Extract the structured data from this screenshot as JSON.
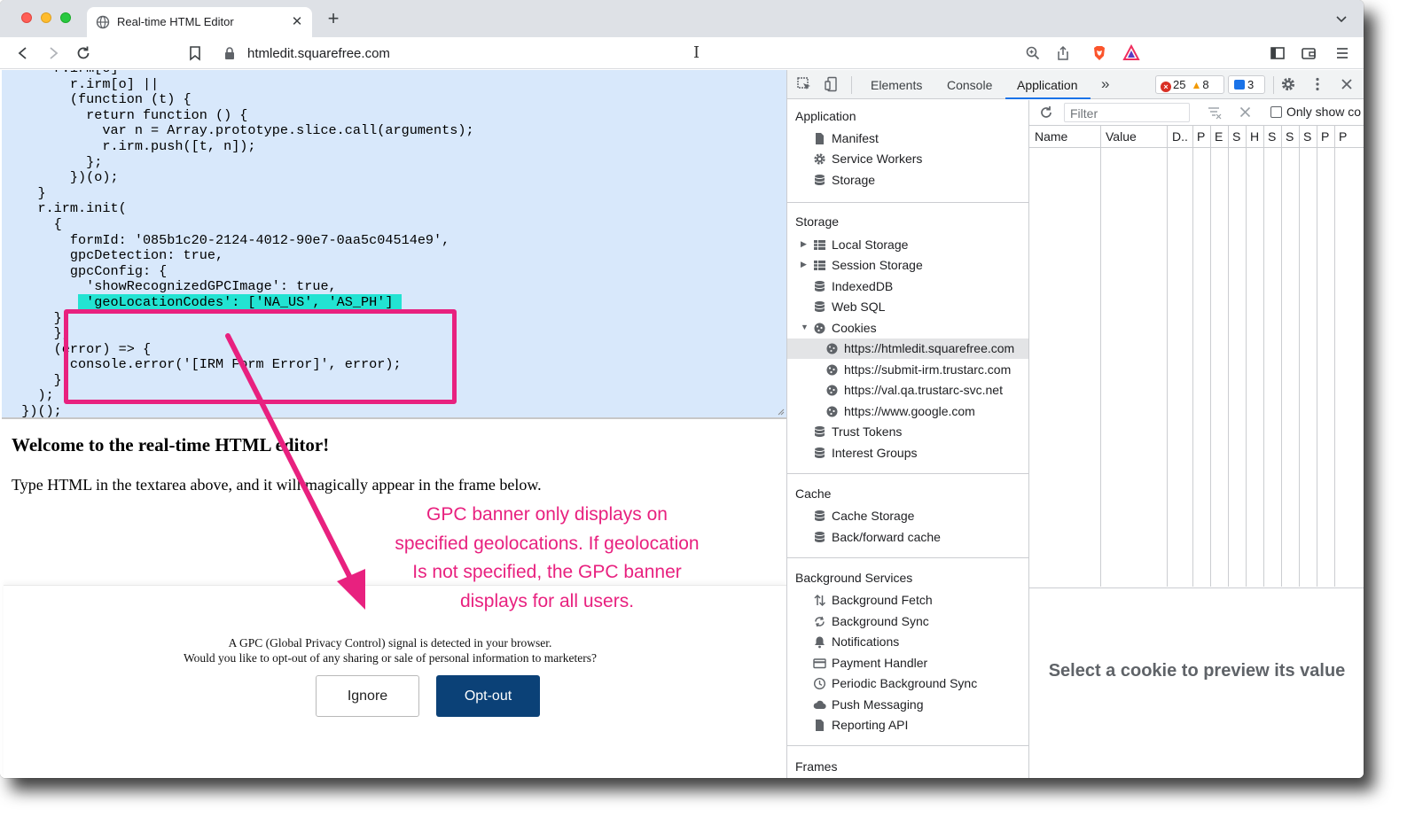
{
  "browser": {
    "tab_title": "Real-time HTML Editor",
    "new_tab_symbol": "+",
    "tab_close_symbol": "✕",
    "url": "htmledit.squarefree.com",
    "brand_color": "#fb542b"
  },
  "editor": {
    "code_lines": [
      "      r.irm[o] =",
      "        r.irm[o] ||",
      "        (function (t) {",
      "          return function () {",
      "            var n = Array.prototype.slice.call(arguments);",
      "            r.irm.push([t, n]);",
      "          };",
      "        })(o);",
      "    }",
      "    r.irm.init(",
      "      {",
      "        formId: '085b1c20-2124-4012-90e7-0aa5c04514e9',",
      "        gpcDetection: true,",
      "        gpcConfig: {",
      "          'showRecognizedGPCImage': true,",
      "          'geoLocationCodes': ['NA_US', 'AS_PH']",
      "      }",
      "      },",
      "      (error) => {",
      "        console.error('[IRM Form Error]', error);",
      "      }",
      "    );",
      "  })();"
    ],
    "highlight_text": "'geoLocationCodes': ['NA_US', 'AS_PH']",
    "highlight_color": "#22e3d2"
  },
  "frame": {
    "heading": "Welcome to the real-time HTML editor!",
    "intro": "Type HTML in the textarea above, and it will magically appear in the frame below."
  },
  "gpc_banner": {
    "line1": "A GPC (Global Privacy Control) signal is detected in your browser.",
    "line2": "Would you like to opt-out of any sharing or sale of personal information to marketers?",
    "ignore_label": "Ignore",
    "optout_label": "Opt-out",
    "optout_color": "#0b4177"
  },
  "annotation": {
    "lines": [
      "GPC banner only displays on",
      "specified geolocations. If geolocation",
      "Is not specified, the GPC banner",
      "displays for all users."
    ],
    "color": "#e8217f"
  },
  "devtools": {
    "tabs": [
      "Elements",
      "Console",
      "Application"
    ],
    "active_tab": "Application",
    "more_tabs_symbol": "»",
    "errors": "25",
    "warnings": "8",
    "messages": "3",
    "sidebar": {
      "application_title": "Application",
      "application_items": [
        "Manifest",
        "Service Workers",
        "Storage"
      ],
      "storage_title": "Storage",
      "storage_items": [
        "Local Storage",
        "Session Storage",
        "IndexedDB",
        "Web SQL",
        "Cookies"
      ],
      "cookie_origins": [
        "https://htmledit.squarefree.com",
        "https://submit-irm.trustarc.com",
        "https://val.qa.trustarc-svc.net",
        "https://www.google.com"
      ],
      "selected_origin": "https://htmledit.squarefree.com",
      "storage_items_after": [
        "Trust Tokens",
        "Interest Groups"
      ],
      "cache_title": "Cache",
      "cache_items": [
        "Cache Storage",
        "Back/forward cache"
      ],
      "background_title": "Background Services",
      "background_items": [
        "Background Fetch",
        "Background Sync",
        "Notifications",
        "Payment Handler",
        "Periodic Background Sync",
        "Push Messaging",
        "Reporting API"
      ],
      "frames_title": "Frames"
    },
    "cookies": {
      "filter_placeholder": "Filter",
      "only_show_label": "Only show co",
      "only_show_checked": false,
      "columns": [
        "Name",
        "Value",
        "D..",
        "P",
        "E",
        "S",
        "H",
        "S",
        "S",
        "S",
        "P",
        "P"
      ],
      "preview_message": "Select a cookie to preview its value"
    }
  }
}
